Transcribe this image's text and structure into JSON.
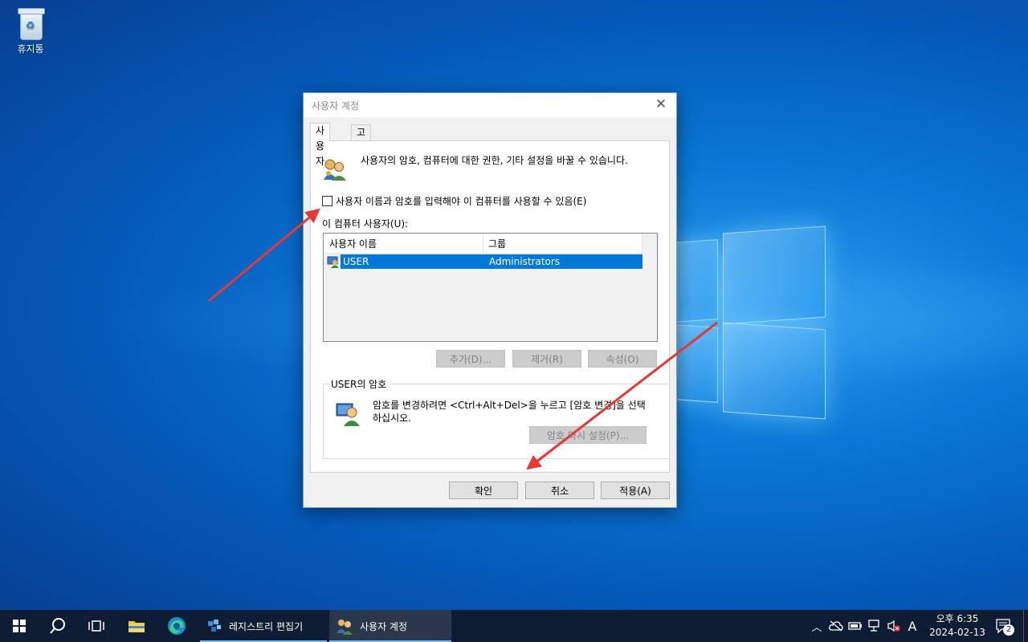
{
  "desktop": {
    "recycle_bin_label": "휴지통"
  },
  "dialog": {
    "title": "사용자 계정",
    "tabs": [
      "사용자",
      "고급"
    ],
    "info_text": "사용자의 암호, 컴퓨터에 대한 권한, 기타 설정을 바꿀 수 있습니다.",
    "require_login_label": "사용자 이름과 암호를 입력해야 이 컴퓨터를 사용할 수 있음(E)",
    "require_login_checked": false,
    "users_label": "이 컴퓨터 사용자(U):",
    "columns": [
      "사용자 이름",
      "그룹"
    ],
    "rows": [
      {
        "name": "USER",
        "group": "Administrators",
        "selected": true
      }
    ],
    "buttons": {
      "add": "추가(D)...",
      "remove": "제거(R)",
      "properties": "속성(O)"
    },
    "password_group_title": "USER의 암호",
    "password_text": "암호를 변경하려면 <Ctrl+Alt+Del>을 누르고 [암호 변경]을 선택하십시오.",
    "reset_password": "암호 다시 설정(P)...",
    "ok": "확인",
    "cancel": "취소",
    "apply": "적용(A)"
  },
  "taskbar": {
    "apps": [
      {
        "label": "레지스트리 편집기",
        "icon": "registry-editor-icon"
      },
      {
        "label": "사용자 계정",
        "icon": "user-accounts-icon"
      }
    ],
    "ime": "A",
    "time": "오후 6:35",
    "date": "2024-02-13",
    "notifications": "2"
  },
  "colors": {
    "selection": "#0078d7",
    "taskbar": "#0e1d33",
    "arrow": "#e53935"
  }
}
